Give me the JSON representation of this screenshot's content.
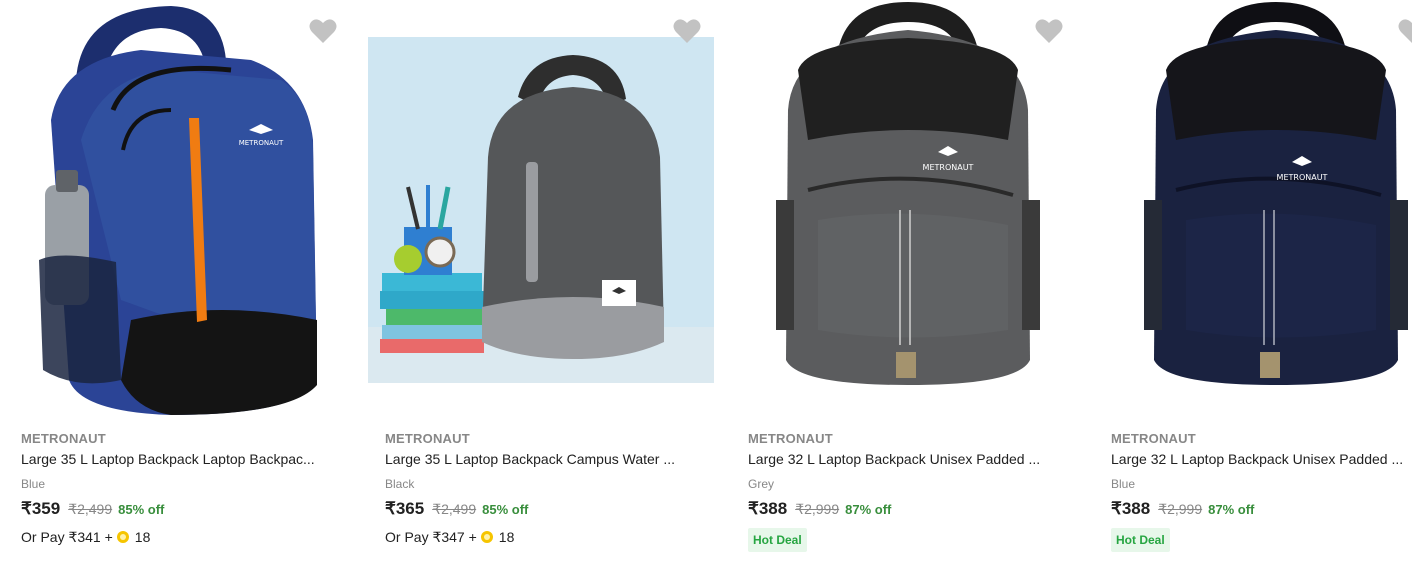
{
  "products": [
    {
      "brand": "METRONAUT",
      "title": "Large 35 L Laptop Backpack Laptop Backpac...",
      "color": "Blue",
      "price": "₹359",
      "mrp": "₹2,499",
      "discount": "85% off",
      "pay_prefix": "Or Pay ₹341 +",
      "coins": "18",
      "image_logo": "METRONAUT",
      "icon": "heart-icon"
    },
    {
      "brand": "METRONAUT",
      "title": "Large 35 L Laptop Backpack Campus Water ...",
      "color": "Black",
      "price": "₹365",
      "mrp": "₹2,499",
      "discount": "85% off",
      "pay_prefix": "Or Pay ₹347 +",
      "coins": "18",
      "image_logo": "",
      "icon": "heart-icon"
    },
    {
      "brand": "METRONAUT",
      "title": "Large 32 L Laptop Backpack Unisex Padded ...",
      "color": "Grey",
      "price": "₹388",
      "mrp": "₹2,999",
      "discount": "87% off",
      "badge": "Hot Deal",
      "image_logo": "METRONAUT",
      "icon": "heart-icon"
    },
    {
      "brand": "METRONAUT",
      "title": "Large 32 L Laptop Backpack Unisex Padded ...",
      "color": "Blue",
      "price": "₹388",
      "mrp": "₹2,999",
      "discount": "87% off",
      "badge": "Hot Deal",
      "image_logo": "METRONAUT",
      "icon": "heart-icon"
    }
  ],
  "colors": {
    "accent_green": "#388e3c",
    "deal_green": "#26a541",
    "heart": "#c2c2c2"
  }
}
